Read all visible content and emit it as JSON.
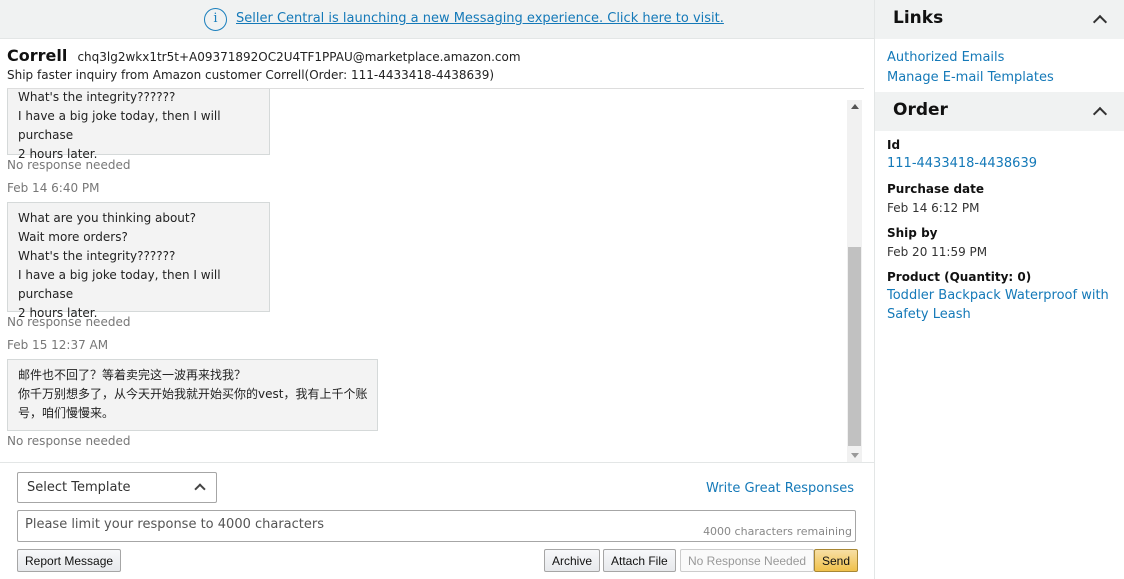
{
  "banner": {
    "info_icon": "info-icon",
    "link": "Seller Central is launching a new Messaging experience. Click here to visit."
  },
  "header": {
    "name": "Correll",
    "email": "chq3lg2wkx1tr5t+A09371892OC2U4TF1PPAU@marketplace.amazon.com",
    "subject": "Ship faster inquiry from Amazon customer Correll(Order: 111-4433418-4438639)"
  },
  "thread": {
    "msg1_lines": [
      "What's the integrity??????",
      "I have a big joke today, then I will purchase",
      "2 hours later."
    ],
    "msg1_note": "No response needed",
    "ts2": "Feb 14 6:40 PM",
    "msg2_lines": [
      "What are you thinking about?",
      "Wait more orders?",
      "What's the integrity??????",
      "I have a big joke today, then I will purchase",
      "2 hours later."
    ],
    "msg2_note": "No response needed",
    "ts3": "Feb 15 12:37 AM",
    "msg3_lines": [
      "邮件也不回了？等着卖完这一波再来找我？",
      "你千万别想多了，从今天开始我就开始买你的vest，我有上千个账",
      "号，咱们慢慢来。"
    ],
    "msg3_note": "No response needed"
  },
  "composer": {
    "select_template": "Select Template",
    "write_great": "Write Great Responses",
    "placeholder": "Please limit your response to 4000 characters",
    "remaining": "4000  characters remaining",
    "report": "Report Message",
    "archive": "Archive",
    "attach": "Attach File",
    "no_response": "No Response Needed",
    "send": "Send"
  },
  "sidebar": {
    "links_title": "Links",
    "authorized_emails": "Authorized Emails",
    "manage_templates": "Manage E-mail Templates",
    "order_title": "Order",
    "id_label": "Id",
    "id_value": "111-4433418-4438639",
    "purchase_label": "Purchase date",
    "purchase_value": "Feb 14 6:12 PM",
    "shipby_label": "Ship by",
    "shipby_value": "Feb 20 11:59 PM",
    "product_label": "Product (Quantity: 0)",
    "product_line1": "Toddler Backpack Waterproof with",
    "product_line2": "Safety Leash"
  }
}
